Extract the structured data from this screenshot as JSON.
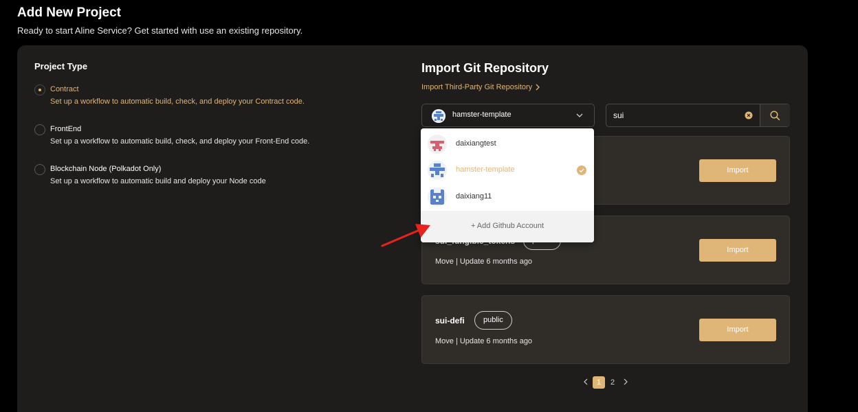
{
  "header": {
    "title": "Add New Project",
    "subtitle": "Ready to start Aline Service? Get started with use an existing repository."
  },
  "project_type": {
    "title": "Project Type",
    "options": [
      {
        "label": "Contract",
        "description": "Set up a workflow to automatic build, check, and deploy your Contract code.",
        "selected": true
      },
      {
        "label": "FrontEnd",
        "description": "Set up a workflow to automatic build, check, and deploy your Front-End code.",
        "selected": false
      },
      {
        "label": "Blockchain Node (Polkadot Only)",
        "description": "Set up a workflow to automatic build and deploy your Node code",
        "selected": false
      }
    ]
  },
  "import": {
    "title": "Import Git Repository",
    "third_party_link": "Import Third-Party Git Repository",
    "selected_account": "hamster-template",
    "search_value": "sui"
  },
  "dropdown": {
    "accounts": [
      {
        "name": "daixiangtest",
        "selected": false,
        "avatar": "identicon-red"
      },
      {
        "name": "hamster-template",
        "selected": true,
        "avatar": "identicon-blue"
      },
      {
        "name": "daixiang11",
        "selected": false,
        "avatar": "identicon-blue"
      }
    ],
    "add_account": "+ Add Github Account"
  },
  "repos": [
    {
      "name": "",
      "badge": "",
      "meta": "",
      "import_label": "Import"
    },
    {
      "name": "sui_fungible_tokens",
      "badge": "public",
      "meta": "Move | Update 6 months ago",
      "import_label": "Import"
    },
    {
      "name": "sui-defi",
      "badge": "public",
      "meta": "Move | Update 6 months ago",
      "import_label": "Import"
    }
  ],
  "pagination": {
    "pages": [
      "1",
      "2"
    ],
    "current": "1"
  },
  "colors": {
    "accent": "#e0b578",
    "background": "#000000",
    "panel": "#1e1d1b",
    "card": "#302d29",
    "arrow": "#e8231d"
  }
}
